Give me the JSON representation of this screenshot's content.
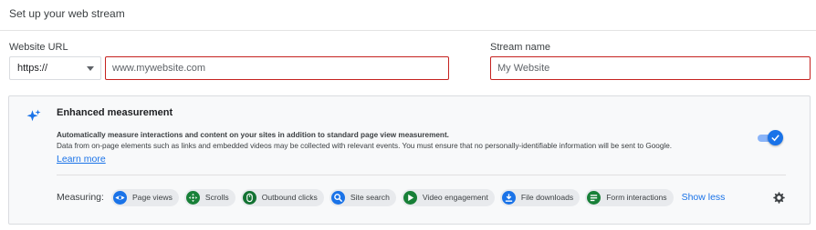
{
  "header": {
    "title": "Set up your web stream"
  },
  "form": {
    "website_url_label": "Website URL",
    "protocol": {
      "selected": "https://"
    },
    "url_placeholder": "www.mywebsite.com",
    "stream_name_label": "Stream name",
    "stream_name_placeholder": "My Website"
  },
  "enhanced": {
    "title": "Enhanced measurement",
    "description_bold": "Automatically measure interactions and content on your sites in addition to standard page view measurement.",
    "description": "Data from on-page elements such as links and embedded videos may be collected with relevant events. You must ensure that no personally-identifiable information will be sent to Google.",
    "learn_more": "Learn more",
    "enabled": true,
    "measuring_label": "Measuring:",
    "chips": [
      {
        "label": "Page views",
        "icon": "eye-icon",
        "color": "#1a73e8"
      },
      {
        "label": "Scrolls",
        "icon": "crosshair-icon",
        "color": "#188038"
      },
      {
        "label": "Outbound clicks",
        "icon": "mouse-icon",
        "color": "#137333"
      },
      {
        "label": "Site search",
        "icon": "search-icon",
        "color": "#1a73e8"
      },
      {
        "label": "Video engagement",
        "icon": "play-icon",
        "color": "#188038"
      },
      {
        "label": "File downloads",
        "icon": "download-icon",
        "color": "#1a73e8"
      },
      {
        "label": "Form interactions",
        "icon": "form-icon",
        "color": "#188038"
      }
    ],
    "show_less": "Show less"
  },
  "colors": {
    "accent": "#1a73e8",
    "error_border": "#c5221f",
    "panel_bg": "#f8f9fa"
  }
}
